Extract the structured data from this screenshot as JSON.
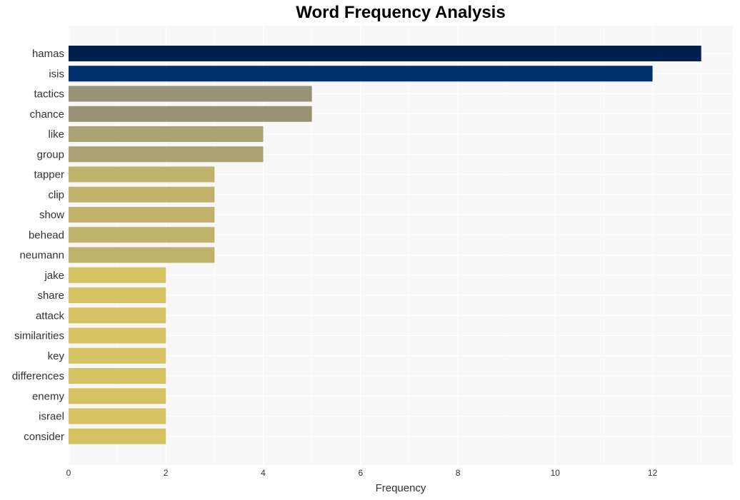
{
  "chart_data": {
    "type": "bar",
    "orientation": "horizontal",
    "title": "Word Frequency Analysis",
    "xlabel": "Frequency",
    "ylabel": "",
    "xlim": [
      0,
      13.65
    ],
    "xticks": [
      0,
      2,
      4,
      6,
      8,
      10,
      12
    ],
    "grid": true,
    "categories": [
      "hamas",
      "isis",
      "tactics",
      "chance",
      "like",
      "group",
      "tapper",
      "clip",
      "show",
      "behead",
      "neumann",
      "jake",
      "share",
      "attack",
      "similarities",
      "key",
      "differences",
      "enemy",
      "israel",
      "consider"
    ],
    "values": [
      13,
      12,
      5,
      5,
      4,
      4,
      3,
      3,
      3,
      3,
      3,
      2,
      2,
      2,
      2,
      2,
      2,
      2,
      2,
      2
    ],
    "colors": [
      "#00214d",
      "#002f6c",
      "#979175",
      "#979175",
      "#aba274",
      "#aba274",
      "#c0b26b",
      "#c0b26b",
      "#c0b26b",
      "#c0b26b",
      "#c0b26b",
      "#d5c262",
      "#d5c262",
      "#d5c262",
      "#d5c262",
      "#d5c262",
      "#d5c262",
      "#d5c262",
      "#d5c262",
      "#d5c262"
    ]
  },
  "colors": {
    "plot_background": "#f7f7f7",
    "gridline": "#ffffff"
  }
}
